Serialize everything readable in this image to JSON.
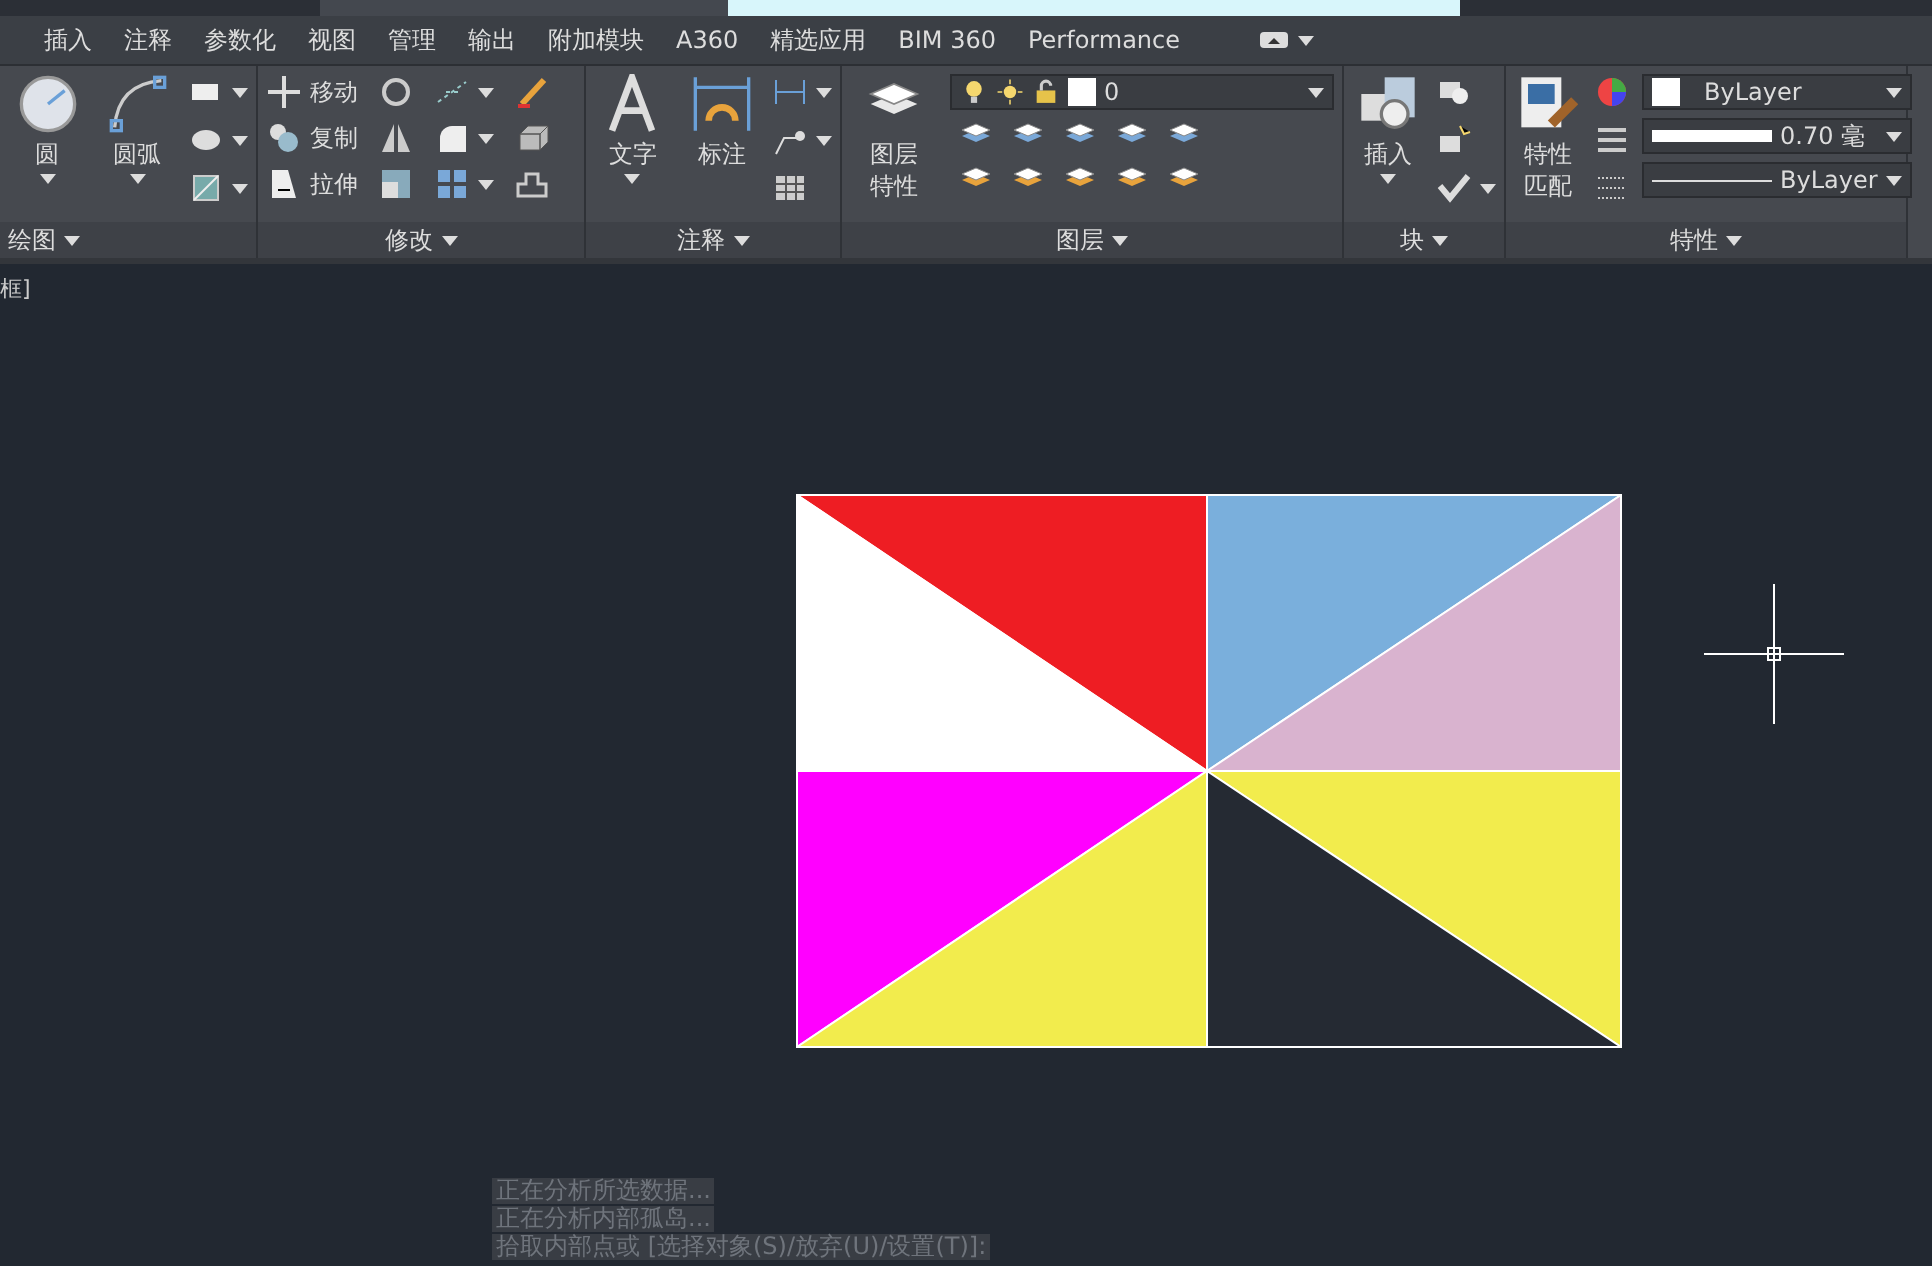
{
  "tabs": [
    "插入",
    "注释",
    "参数化",
    "视图",
    "管理",
    "输出",
    "附加模块",
    "A360",
    "精选应用",
    "BIM 360",
    "Performance"
  ],
  "ribbon": {
    "draw": {
      "label": "绘图",
      "big": [
        "圆",
        "圆弧"
      ]
    },
    "modify": {
      "label": "修改",
      "tools": [
        "移动",
        "复制",
        "拉伸"
      ]
    },
    "annotate": {
      "label": "注释",
      "big": [
        "文字",
        "标注"
      ]
    },
    "layers": {
      "label": "图层",
      "big": "图层特性",
      "current_layer": "0"
    },
    "block": {
      "label": "块",
      "big": "插入"
    },
    "properties": {
      "label": "特性",
      "big": "特性匹配",
      "color_setting": "ByLayer",
      "lineweight": "0.70 毫",
      "linetype": "ByLayer"
    }
  },
  "viewport_label": "框]",
  "drawing": {
    "regions": [
      {
        "color": "#ee1d23"
      },
      {
        "color": "#ffffff"
      },
      {
        "color": "#7aafdc"
      },
      {
        "color": "#d9b3cf"
      },
      {
        "color": "#ff00ff"
      },
      {
        "color": "#f2ec4d"
      },
      {
        "color": "#f2ec4d"
      },
      {
        "color": "#252a33"
      }
    ]
  },
  "command_history": [
    "正在分析所选数据...",
    "正在分析内部孤岛...",
    "拾取内部点或 [选择对象(S)/放弃(U)/设置(T)]:"
  ]
}
